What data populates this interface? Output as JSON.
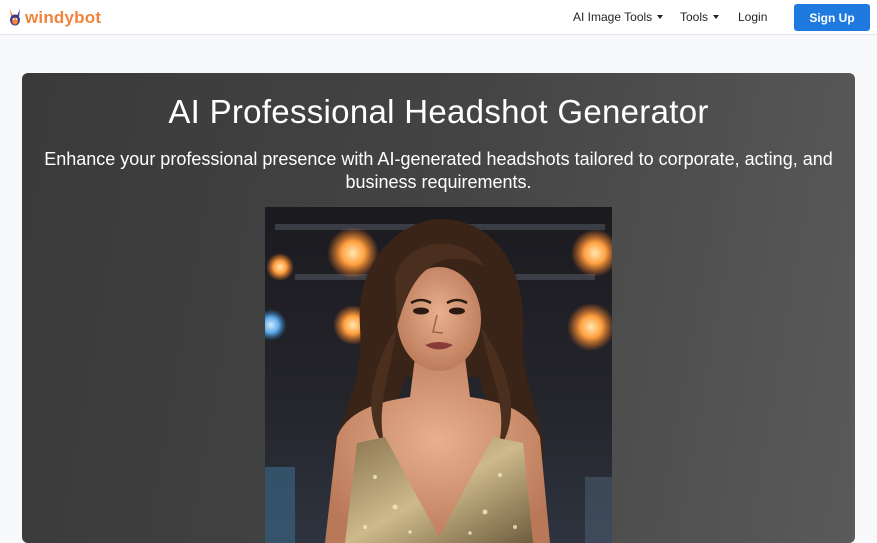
{
  "nav": {
    "brand": "windybot",
    "items": [
      {
        "label": "AI Image Tools",
        "has_caret": true
      },
      {
        "label": "Tools",
        "has_caret": true
      },
      {
        "label": "Login",
        "has_caret": false
      }
    ],
    "signup_label": "Sign Up"
  },
  "hero": {
    "title": "AI Professional Headshot Generator",
    "subtitle": "Enhance your professional presence with AI-generated headshots tailored to corporate, acting, and business requirements."
  },
  "colors": {
    "brand": "#f0843c",
    "primary_button": "#1f7ae0",
    "hero_background": "#444444"
  },
  "icons": [
    "rabbit-logo-icon",
    "caret-down-icon"
  ]
}
